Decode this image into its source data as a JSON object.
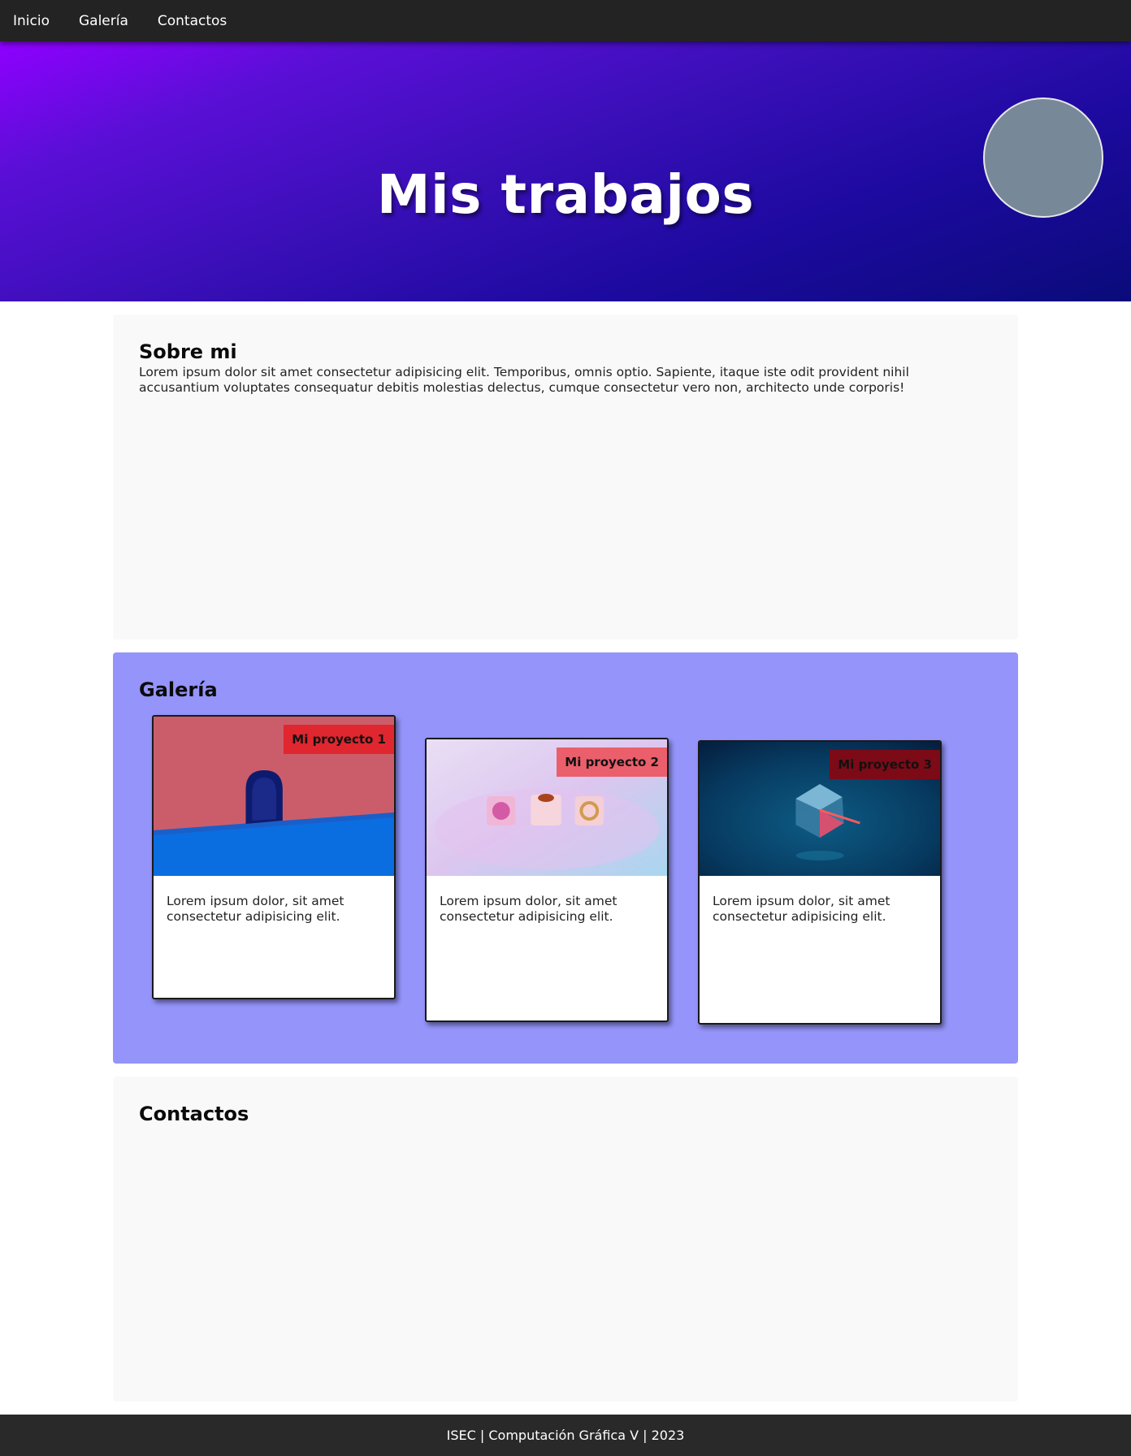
{
  "nav": {
    "items": [
      {
        "label": "Inicio"
      },
      {
        "label": "Galería"
      },
      {
        "label": "Contactos"
      }
    ]
  },
  "hero": {
    "title": "Mis trabajos"
  },
  "about": {
    "title": "Sobre mi",
    "text": "Lorem ipsum dolor sit amet consectetur adipisicing elit. Temporibus, omnis optio. Sapiente, itaque iste odit provident nihil accusantium voluptates consequatur debitis molestias delectus, cumque consectetur vero non, architecto unde corporis!"
  },
  "gallery": {
    "title": "Galería",
    "cards": [
      {
        "badge": "Mi proyecto 1",
        "badge_color": "#e0262e",
        "text": "Lorem ipsum dolor, sit amet consectetur adipisicing elit."
      },
      {
        "badge": "Mi proyecto 2",
        "badge_color": "#ea5f6b",
        "text": "Lorem ipsum dolor, sit amet consectetur adipisicing elit."
      },
      {
        "badge": "Mi proyecto 3",
        "badge_color": "#7d0a17",
        "text": "Lorem ipsum dolor, sit amet consectetur adipisicing elit."
      }
    ]
  },
  "contacts": {
    "title": "Contactos"
  },
  "footer": {
    "text": "ISEC | Computación Gráfica V | 2023"
  },
  "colors": {
    "nav_bg": "#232323",
    "gallery_bg": "#9494fa",
    "section_bg": "#f9f9f9",
    "footer_bg": "#292929",
    "avatar": "#778899"
  }
}
